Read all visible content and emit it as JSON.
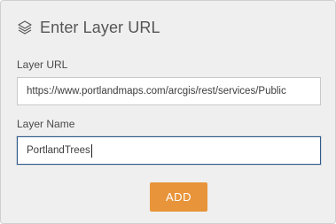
{
  "header": {
    "title": "Enter Layer URL",
    "icon": "layers-icon"
  },
  "form": {
    "url_label": "Layer URL",
    "url_value": "https://www.portlandmaps.com/arcgis/rest/services/Public",
    "name_label": "Layer Name",
    "name_value": "PortlandTrees"
  },
  "actions": {
    "add_label": "ADD"
  },
  "colors": {
    "panel_bg": "#efefef",
    "accent_button": "#e8943a",
    "focus_border": "#2f5a8a"
  }
}
